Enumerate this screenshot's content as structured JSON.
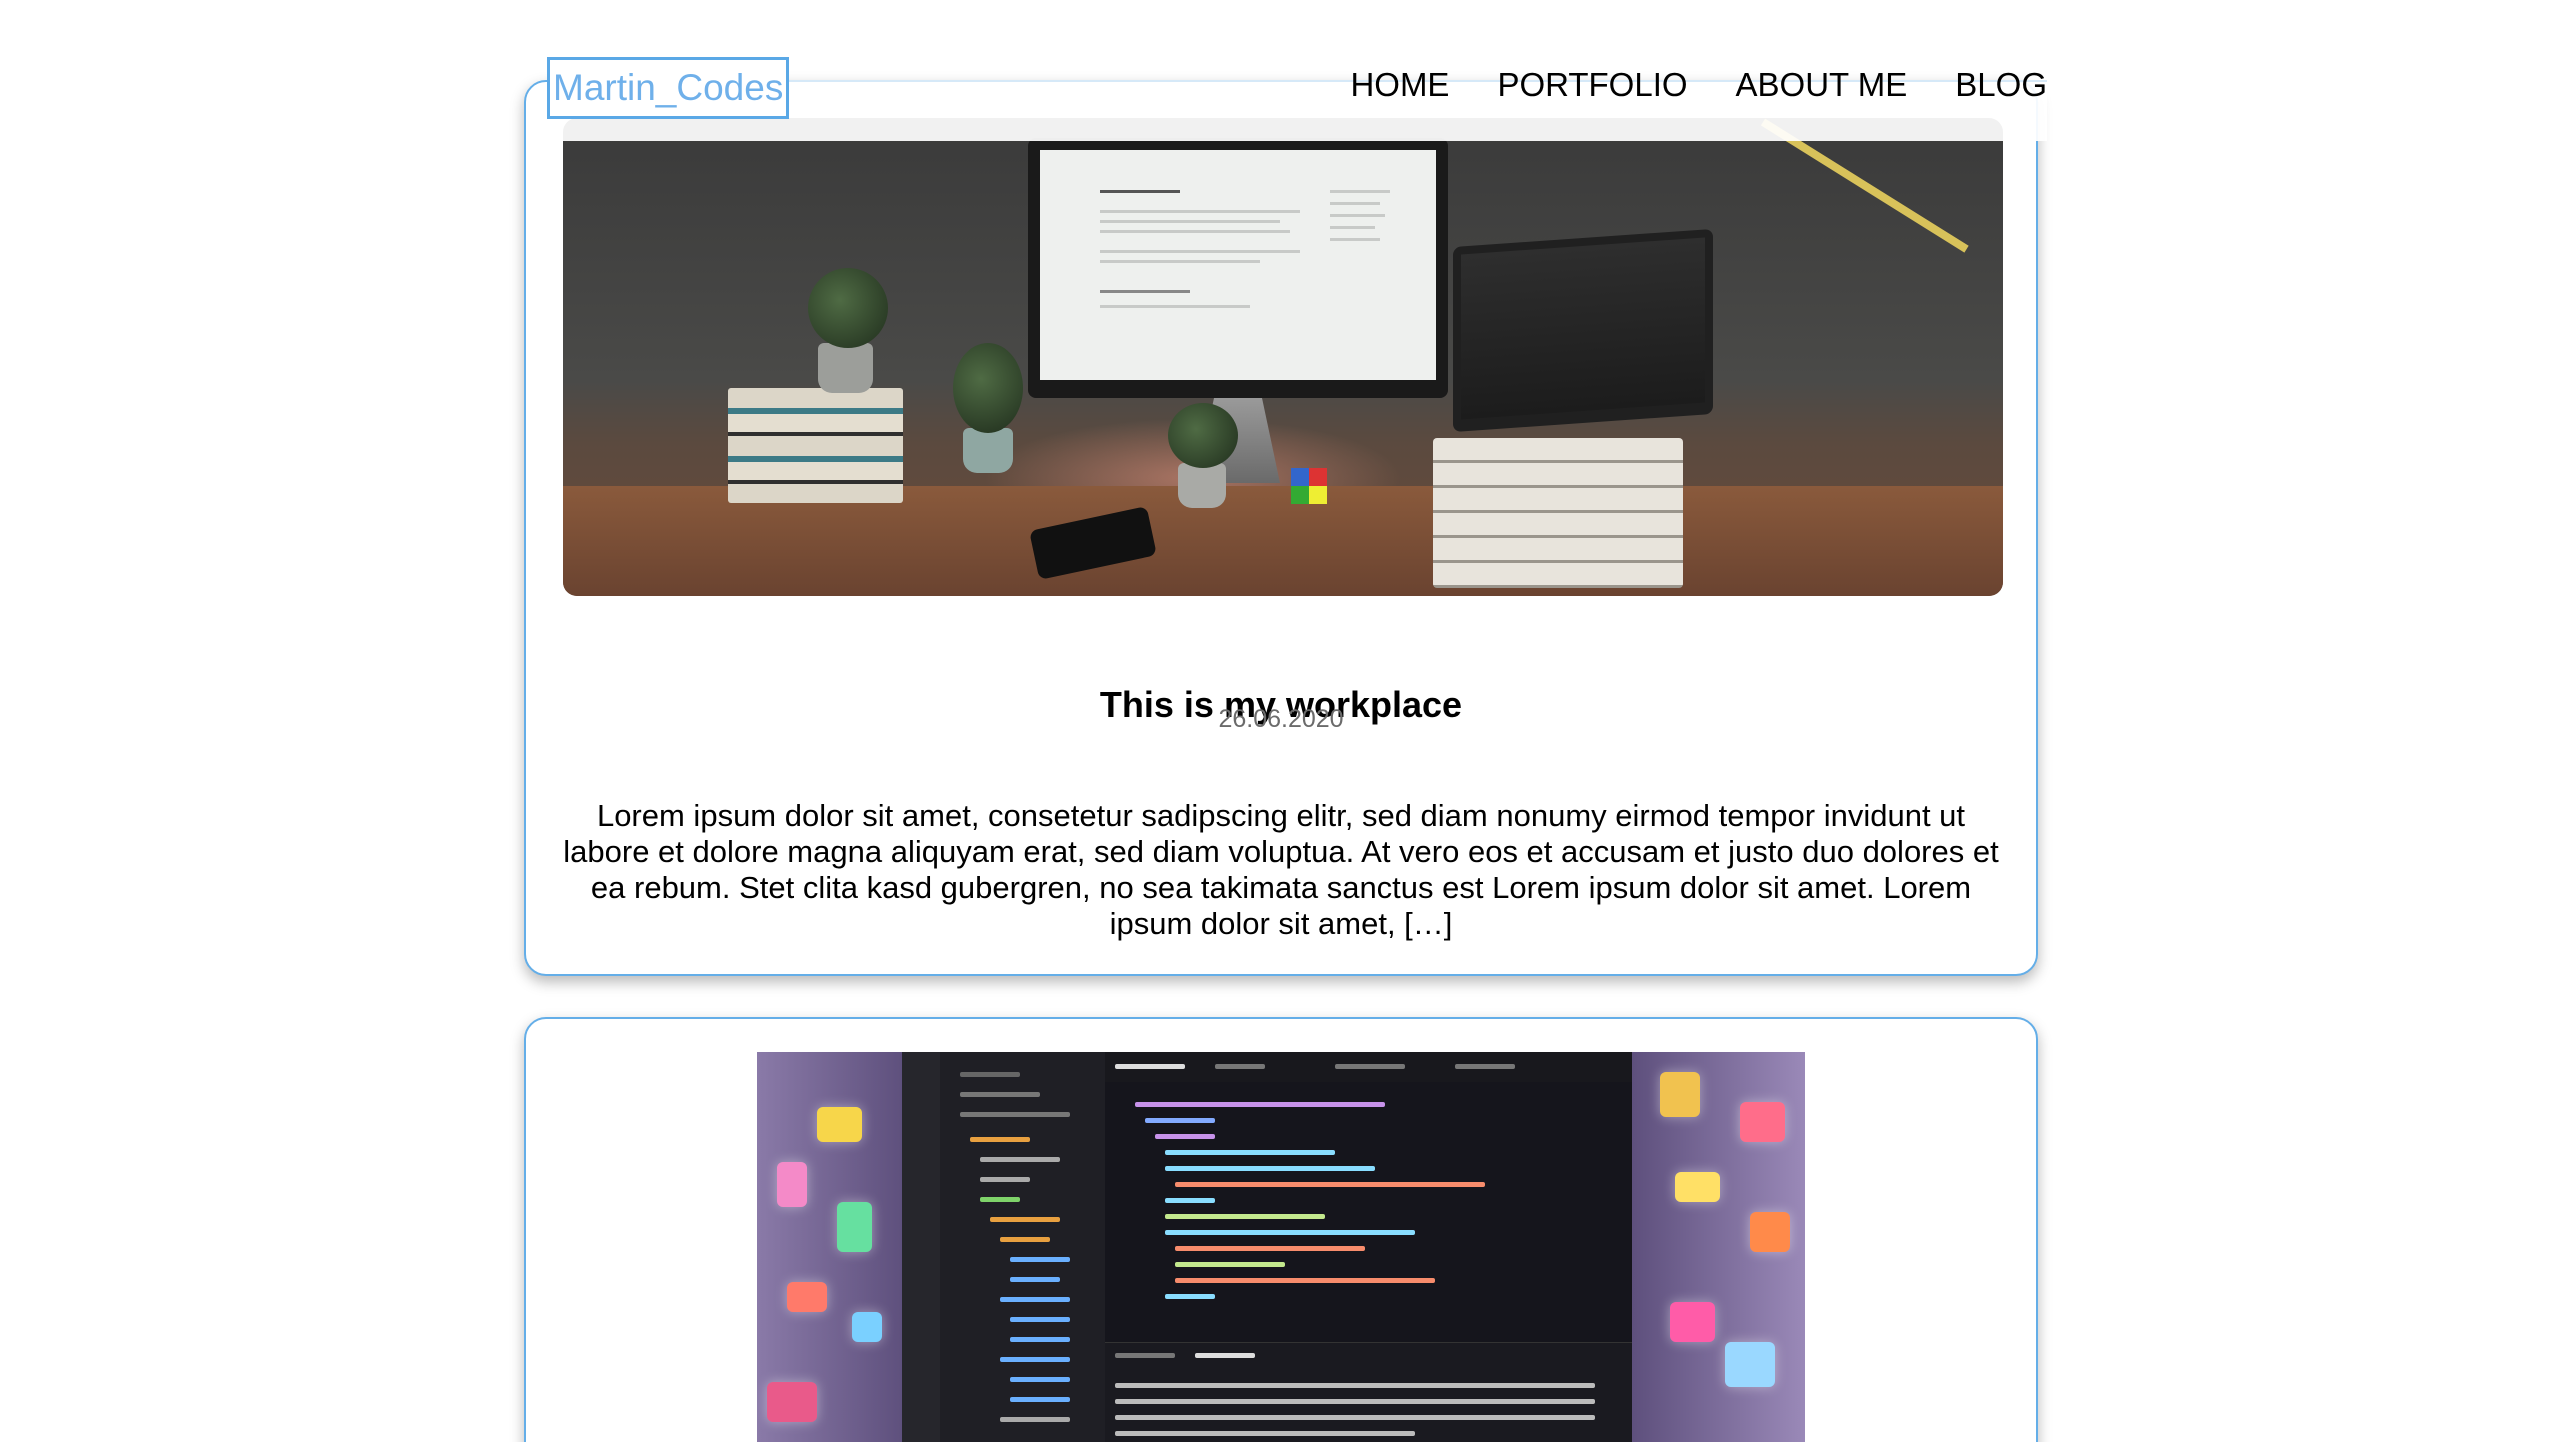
{
  "header": {
    "logo": "Martin_Codes",
    "nav": [
      "HOME",
      "PORTFOLIO",
      "ABOUT ME",
      "BLOG"
    ]
  },
  "posts": [
    {
      "image_icon": "workplace-photo",
      "title": "This is my workplace",
      "date": "26.06.2020",
      "excerpt": "Lorem ipsum dolor sit amet, consetetur sadipscing elitr, sed diam nonumy eirmod tempor invidunt ut labore et dolore magna aliquyam erat, sed diam voluptua. At vero eos et accusam et justo duo dolores et ea rebum. Stet clita kasd gubergren, no sea takimata sanctus est Lorem ipsum dolor sit amet. Lorem ipsum dolor sit amet, […]"
    },
    {
      "image_icon": "code-editor-photo"
    }
  ],
  "colors": {
    "accent": "#64aee8",
    "logo_text": "#6fb0ea",
    "date_text": "#6b6b6b"
  }
}
